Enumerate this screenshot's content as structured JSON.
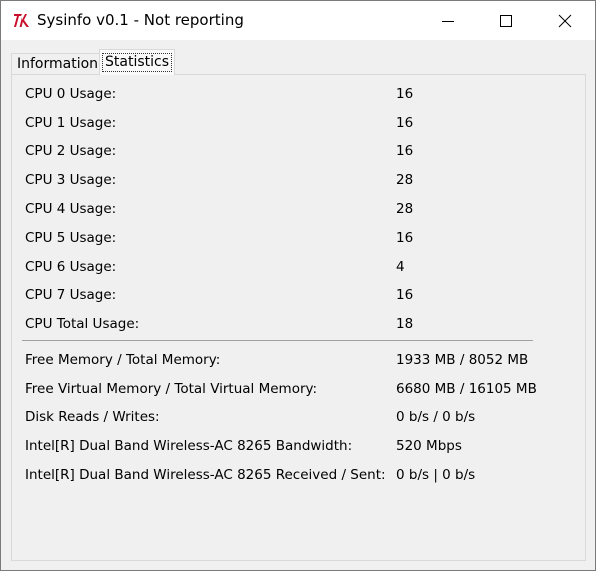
{
  "window": {
    "title": "Sysinfo v0.1 - Not reporting",
    "app_icon": "tk-feather-icon"
  },
  "tabs": [
    {
      "label": "Information",
      "selected": false
    },
    {
      "label": "Statistics",
      "selected": true
    }
  ],
  "cpu_stats": [
    {
      "label": "CPU 0 Usage:",
      "value": "16"
    },
    {
      "label": "CPU 1 Usage:",
      "value": "16"
    },
    {
      "label": "CPU 2 Usage:",
      "value": "16"
    },
    {
      "label": "CPU 3 Usage:",
      "value": "28"
    },
    {
      "label": "CPU 4 Usage:",
      "value": "28"
    },
    {
      "label": "CPU 5 Usage:",
      "value": "16"
    },
    {
      "label": "CPU 6 Usage:",
      "value": "4"
    },
    {
      "label": "CPU 7 Usage:",
      "value": "16"
    },
    {
      "label": "CPU Total Usage:",
      "value": "18"
    }
  ],
  "system_stats": [
    {
      "label": "Free Memory / Total Memory:",
      "value": "1933 MB / 8052 MB"
    },
    {
      "label": "Free Virtual Memory / Total Virtual Memory:",
      "value": "6680 MB / 16105 MB"
    },
    {
      "label": "Disk Reads / Writes:",
      "value": "0 b/s / 0 b/s"
    },
    {
      "label": "Intel[R] Dual Band Wireless-AC 8265 Bandwidth:",
      "value": "520 Mbps"
    },
    {
      "label": "Intel[R] Dual Band Wireless-AC 8265 Received / Sent:",
      "value": "0 b/s | 0 b/s"
    }
  ]
}
